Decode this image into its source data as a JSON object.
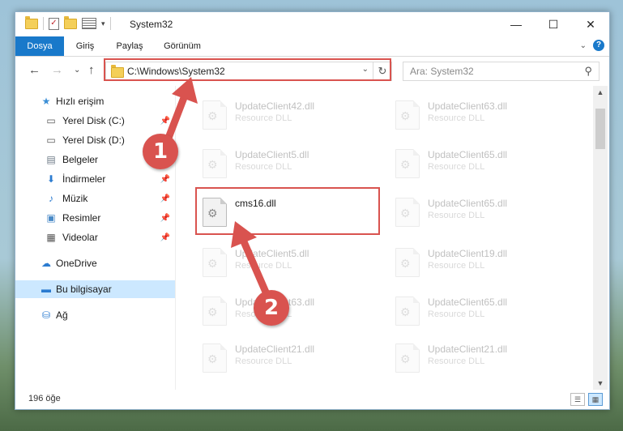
{
  "window": {
    "title": "System32",
    "controls": {
      "minimize": "—",
      "maximize": "☐",
      "close": "✕"
    }
  },
  "ribbon": {
    "tabs": [
      {
        "label": "Dosya"
      },
      {
        "label": "Giriş"
      },
      {
        "label": "Paylaş"
      },
      {
        "label": "Görünüm"
      }
    ],
    "help": "?"
  },
  "navigation": {
    "address": "C:\\Windows\\System32",
    "search_placeholder": "Ara: System32"
  },
  "sidebar": {
    "items": [
      {
        "label": "Hızlı erişim",
        "icon": "star-icon"
      },
      {
        "label": "Yerel Disk (C:)",
        "icon": "drive-icon"
      },
      {
        "label": "Yerel Disk (D:)",
        "icon": "drive-icon"
      },
      {
        "label": "Belgeler",
        "icon": "documents-icon"
      },
      {
        "label": "İndirmeler",
        "icon": "download-icon"
      },
      {
        "label": "Müzik",
        "icon": "music-icon"
      },
      {
        "label": "Resimler",
        "icon": "pictures-icon"
      },
      {
        "label": "Videolar",
        "icon": "videos-icon"
      },
      {
        "label": "OneDrive",
        "icon": "cloud-icon"
      },
      {
        "label": "Bu bilgisayar",
        "icon": "computer-icon"
      },
      {
        "label": "Ağ",
        "icon": "network-icon"
      }
    ]
  },
  "files": [
    {
      "name": "UpdateClient42.dll",
      "type": "Resource DLL"
    },
    {
      "name": "UpdateClient63.dll",
      "type": "Resource DLL"
    },
    {
      "name": "UpdateClient5.dll",
      "type": "Resource DLL"
    },
    {
      "name": "UpdateClient65.dll",
      "type": "Resource DLL"
    },
    {
      "name": "cms16.dll",
      "type": ""
    },
    {
      "name": "UpdateClient65.dll",
      "type": "Resource DLL"
    },
    {
      "name": "UpdateClient5.dll",
      "type": "Resource DLL"
    },
    {
      "name": "UpdateClient19.dll",
      "type": "Resource DLL"
    },
    {
      "name": "UpdateClient63.dll",
      "type": "Resource DLL"
    },
    {
      "name": "UpdateClient65.dll",
      "type": "Resource DLL"
    },
    {
      "name": "UpdateClient21.dll",
      "type": "Resource DLL"
    },
    {
      "name": "UpdateClient21.dll",
      "type": "Resource DLL"
    }
  ],
  "status": {
    "item_count": "196 öğe"
  },
  "annotations": {
    "badge1": "1",
    "badge2": "2",
    "color": "#d9534f"
  }
}
